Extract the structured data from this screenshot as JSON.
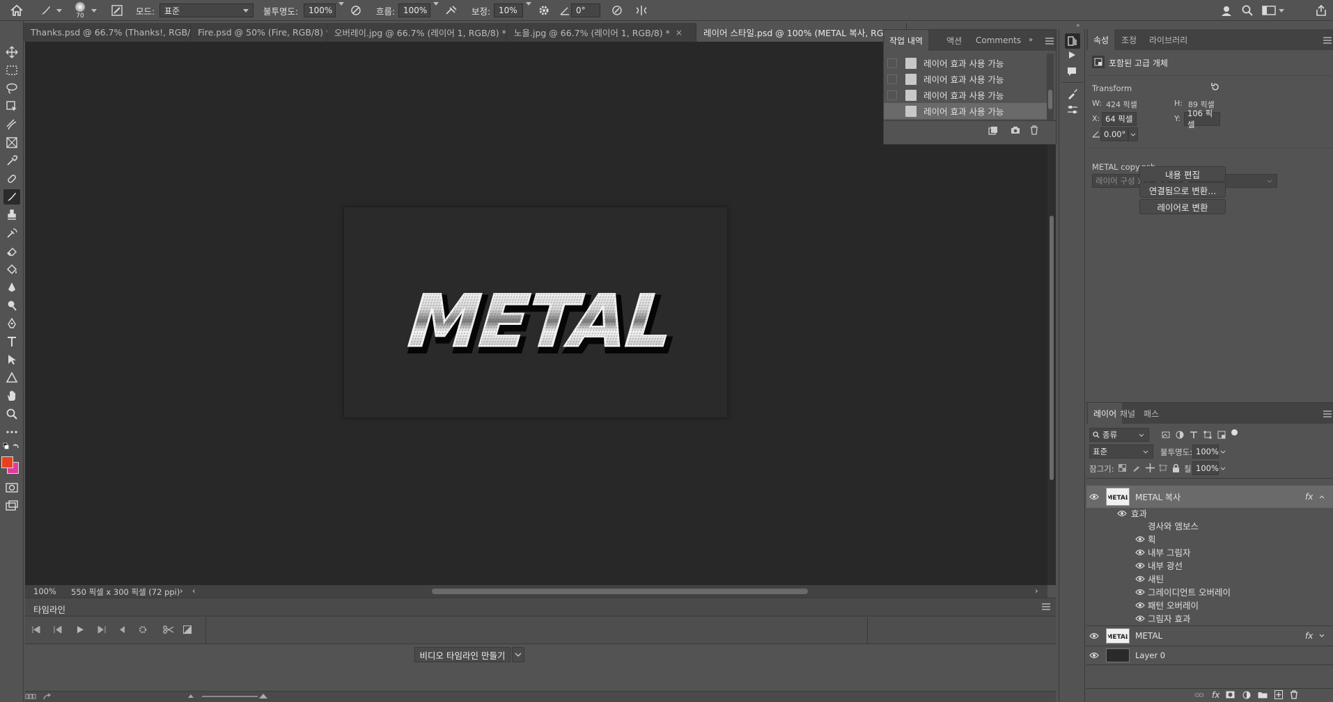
{
  "options_bar": {
    "brush_size": "70",
    "mode_label": "모드:",
    "mode_value": "표준",
    "opacity_label": "불투명도:",
    "opacity_value": "100%",
    "flow_label": "흐름:",
    "flow_value": "100%",
    "smoothing_label": "보정:",
    "smoothing_value": "10%",
    "angle_value": "0°"
  },
  "tabs": [
    {
      "label": "Thanks.psd @ 66.7% (Thanks!, RGB/8) *"
    },
    {
      "label": "Fire.psd @ 50% (Fire, RGB/8) *"
    },
    {
      "label": "오버레이.jpg @ 66.7% (레이어 1, RGB/8) *"
    },
    {
      "label": "노을.jpg @ 66.7% (레이어 1, RGB/8) *"
    },
    {
      "label": "레이어 스타일.psd @ 100% (METAL 복사, RGB/8) *"
    }
  ],
  "canvas": {
    "text": "METAL"
  },
  "status_bar": {
    "zoom": "100%",
    "doc_info": "550 픽셀 x 300 픽셀 (72 ppi)"
  },
  "timeline": {
    "title": "타임라인",
    "create_button": "비디오 타임라인 만들기"
  },
  "history_panel": {
    "tabs": [
      "작업 내역",
      "액션",
      "Comments"
    ],
    "items": [
      "레이어 효과 사용 가능",
      "레이어 효과 사용 가능",
      "레이어 효과 사용 가능",
      "레이어 효과 사용 가능"
    ]
  },
  "properties_panel": {
    "tabs": [
      "속성",
      "조정",
      "라이브러리"
    ],
    "object_type": "포함된 고급 개체",
    "transform_label": "Transform",
    "w_label": "W:",
    "w_value": "424 픽셀",
    "h_label": "H:",
    "h_value": "89 픽셀",
    "x_label": "X:",
    "x_value": "64 픽셀",
    "y_label": "Y:",
    "y_value": "106 픽셀",
    "angle_value": "0.00°",
    "file_name": "METAL copy.psb",
    "comp_placeholder": "레이어 구성 요소 적용 안 함",
    "buttons": [
      "내용 편집",
      "연결됨으로 변환...",
      "레이어로 변환"
    ]
  },
  "layers_panel": {
    "tabs": [
      "레이어",
      "채널",
      "패스"
    ],
    "filter_label": "종류",
    "blend_mode": "표준",
    "opacity_label": "불투명도:",
    "opacity_value": "100%",
    "lock_label": "잠그기:",
    "fill_label": "칠:",
    "fill_value": "100%",
    "layers": [
      {
        "name": "METAL 복사"
      },
      {
        "name": "METAL"
      },
      {
        "name": "Layer 0"
      }
    ],
    "effects_label": "효과",
    "effects": [
      "경사와 엠보스",
      "획",
      "내부 그림자",
      "내부 광선",
      "새틴",
      "그레이디언트 오버레이",
      "패턴 오버레이",
      "그림자 효과"
    ],
    "fx_label": "fx"
  },
  "colors": {
    "foreground": "#e8401c",
    "background": "#e23aa0"
  }
}
